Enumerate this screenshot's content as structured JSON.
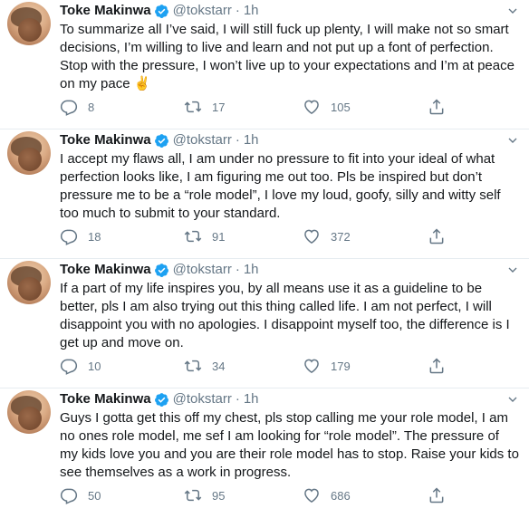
{
  "colors": {
    "text": "#14171a",
    "secondary": "#657786",
    "verified": "#1da1f2",
    "divider": "#e6ecf0"
  },
  "icons": {
    "verified": "verified-badge-icon",
    "reply": "reply-icon",
    "retweet": "retweet-icon",
    "like": "like-icon",
    "share": "share-icon",
    "more": "chevron-down-icon"
  },
  "tweets": [
    {
      "name": "Toke Makinwa",
      "handle": "@tokstarr",
      "separator": "·",
      "time": "1h",
      "text": "To summarize all I’ve said, I will still fuck up plenty, I will make not so smart decisions, I’m willing to live and learn and not put up a font of perfection. Stop with the pressure, I won’t live up to your expectations and I’m at peace on my pace ✌️",
      "replies": "8",
      "retweets": "17",
      "likes": "105"
    },
    {
      "name": "Toke Makinwa",
      "handle": "@tokstarr",
      "separator": "·",
      "time": "1h",
      "text": "I accept my flaws all, I am under no pressure to fit into your ideal of what perfection looks like, I am figuring me out too. Pls be inspired but don’t pressure me to be a “role model”, I love my loud, goofy, silly and witty self too much to submit to your standard.",
      "replies": "18",
      "retweets": "91",
      "likes": "372"
    },
    {
      "name": "Toke Makinwa",
      "handle": "@tokstarr",
      "separator": "·",
      "time": "1h",
      "text": "If a part of my life inspires you, by all means use it as a guideline to be better, pls I am also trying out this thing called life. I am not perfect, I will disappoint you with no apologies. I disappoint myself too, the difference is I get up and move on.",
      "replies": "10",
      "retweets": "34",
      "likes": "179"
    },
    {
      "name": "Toke Makinwa",
      "handle": "@tokstarr",
      "separator": "·",
      "time": "1h",
      "text": "Guys I gotta get this off my chest, pls stop calling me your role model, I am no ones role model, me sef I am looking for “role model”. The pressure of my kids love you and you are their role model has to stop. Raise your kids to see themselves as a work in progress.",
      "replies": "50",
      "retweets": "95",
      "likes": "686"
    }
  ]
}
